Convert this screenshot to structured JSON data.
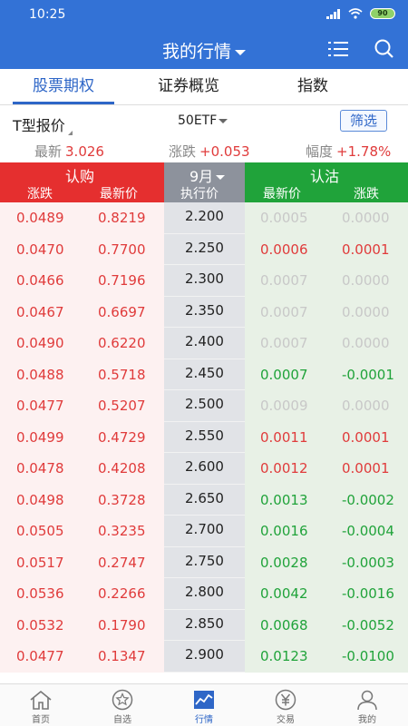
{
  "status": {
    "time": "10:25",
    "battery": "90"
  },
  "header": {
    "title": "我的行情"
  },
  "tabs": [
    "股票期权",
    "证券概览",
    "指数"
  ],
  "toolbar": {
    "quote_type": "T型报价",
    "underlying": "50ETF",
    "filter_label": "筛选"
  },
  "summary": {
    "last_label": "最新",
    "last_value": "3.026",
    "change_label": "涨跌",
    "change_value": "+0.053",
    "pct_label": "幅度",
    "pct_value": "+1.78%"
  },
  "columns": {
    "call_title": "认购",
    "call_change": "涨跌",
    "call_last": "最新价",
    "month": "9月",
    "strike": "执行价",
    "put_title": "认沽",
    "put_last": "最新价",
    "put_change": "涨跌"
  },
  "rows": [
    {
      "call_change": "0.0489",
      "call_last": "0.8219",
      "strike": "2.200",
      "put_last": "0.0005",
      "put_change": "0.0000",
      "put_color": "gray"
    },
    {
      "call_change": "0.0470",
      "call_last": "0.7700",
      "strike": "2.250",
      "put_last": "0.0006",
      "put_change": "0.0001",
      "put_color": "red"
    },
    {
      "call_change": "0.0466",
      "call_last": "0.7196",
      "strike": "2.300",
      "put_last": "0.0007",
      "put_change": "0.0000",
      "put_color": "gray"
    },
    {
      "call_change": "0.0467",
      "call_last": "0.6697",
      "strike": "2.350",
      "put_last": "0.0007",
      "put_change": "0.0000",
      "put_color": "gray"
    },
    {
      "call_change": "0.0490",
      "call_last": "0.6220",
      "strike": "2.400",
      "put_last": "0.0007",
      "put_change": "0.0000",
      "put_color": "gray"
    },
    {
      "call_change": "0.0488",
      "call_last": "0.5718",
      "strike": "2.450",
      "put_last": "0.0007",
      "put_change": "-0.0001",
      "put_color": "green"
    },
    {
      "call_change": "0.0477",
      "call_last": "0.5207",
      "strike": "2.500",
      "put_last": "0.0009",
      "put_change": "0.0000",
      "put_color": "gray"
    },
    {
      "call_change": "0.0499",
      "call_last": "0.4729",
      "strike": "2.550",
      "put_last": "0.0011",
      "put_change": "0.0001",
      "put_color": "red"
    },
    {
      "call_change": "0.0478",
      "call_last": "0.4208",
      "strike": "2.600",
      "put_last": "0.0012",
      "put_change": "0.0001",
      "put_color": "red"
    },
    {
      "call_change": "0.0498",
      "call_last": "0.3728",
      "strike": "2.650",
      "put_last": "0.0013",
      "put_change": "-0.0002",
      "put_color": "green"
    },
    {
      "call_change": "0.0505",
      "call_last": "0.3235",
      "strike": "2.700",
      "put_last": "0.0016",
      "put_change": "-0.0004",
      "put_color": "green"
    },
    {
      "call_change": "0.0517",
      "call_last": "0.2747",
      "strike": "2.750",
      "put_last": "0.0028",
      "put_change": "-0.0003",
      "put_color": "green"
    },
    {
      "call_change": "0.0536",
      "call_last": "0.2266",
      "strike": "2.800",
      "put_last": "0.0042",
      "put_change": "-0.0016",
      "put_color": "green"
    },
    {
      "call_change": "0.0532",
      "call_last": "0.1790",
      "strike": "2.850",
      "put_last": "0.0068",
      "put_change": "-0.0052",
      "put_color": "green"
    },
    {
      "call_change": "0.0477",
      "call_last": "0.1347",
      "strike": "2.900",
      "put_last": "0.0123",
      "put_change": "-0.0100",
      "put_color": "green"
    }
  ],
  "nav": [
    {
      "label": "首页",
      "icon": "home-icon"
    },
    {
      "label": "自选",
      "icon": "star-icon"
    },
    {
      "label": "行情",
      "icon": "chart-icon"
    },
    {
      "label": "交易",
      "icon": "yen-icon"
    },
    {
      "label": "我的",
      "icon": "user-icon"
    }
  ],
  "colors": {
    "brand_blue": "#3372d6",
    "call_red": "#e52f2f",
    "put_green": "#20a33a",
    "strike_gray": "#8d929c"
  }
}
